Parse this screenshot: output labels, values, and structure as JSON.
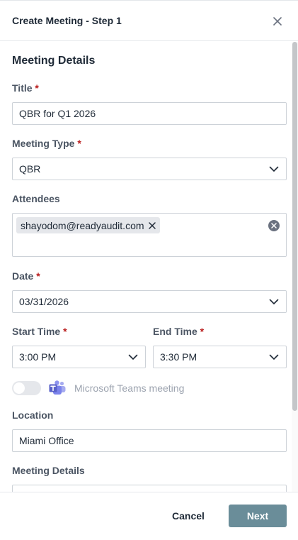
{
  "dialog": {
    "title": "Create Meeting - Step 1"
  },
  "section": {
    "title": "Meeting Details"
  },
  "form": {
    "title_label": "Title",
    "title_value": "QBR for Q1 2026",
    "type_label": "Meeting Type",
    "type_value": "QBR",
    "attendees_label": "Attendees",
    "attendees": [
      "shayodom@readyaudit.com"
    ],
    "date_label": "Date",
    "date_value": "03/31/2026",
    "start_label": "Start Time",
    "start_value": "3:00 PM",
    "end_label": "End Time",
    "end_value": "3:30 PM",
    "teams_label": "Microsoft Teams meeting",
    "teams_enabled": false,
    "location_label": "Location",
    "location_value": "Miami Office",
    "details_label": "Meeting Details",
    "required_mark": "*"
  },
  "footer": {
    "cancel_label": "Cancel",
    "next_label": "Next"
  },
  "colors": {
    "required": "#b91c1c",
    "primary_button": "#6a8d99",
    "teams_purple": "#7b83eb"
  },
  "icons": {
    "close": "close-icon",
    "dropdown": "chevron-down-icon",
    "chip_remove": "close-icon",
    "clear_all": "clear-circle-icon",
    "teams": "microsoft-teams-icon"
  }
}
